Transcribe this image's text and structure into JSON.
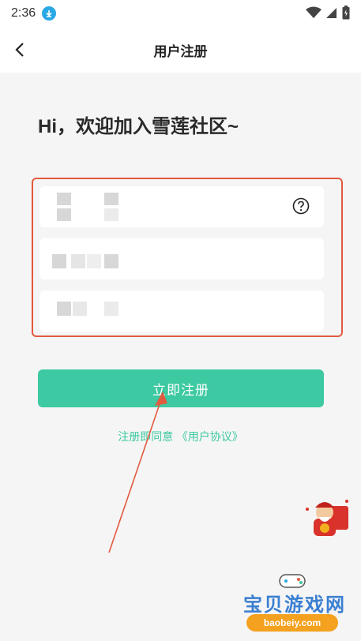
{
  "status_bar": {
    "time": "2:36"
  },
  "nav": {
    "title": "用户注册"
  },
  "greeting": "Hi，欢迎加入雪莲社区~",
  "button": {
    "submit_label": "立即注册"
  },
  "agreement": {
    "prefix": "注册即同意",
    "link": "《用户协议》"
  },
  "watermark": {
    "text": "宝贝游戏网",
    "url": "baobeiy.com"
  },
  "colors": {
    "accent": "#3dc9a1",
    "highlight_border": "#e25a3f",
    "arrow": "#e25a3f"
  },
  "icons": [
    "download-icon",
    "wifi-icon",
    "signal-icon",
    "battery-icon",
    "back-arrow-icon",
    "help-icon"
  ]
}
